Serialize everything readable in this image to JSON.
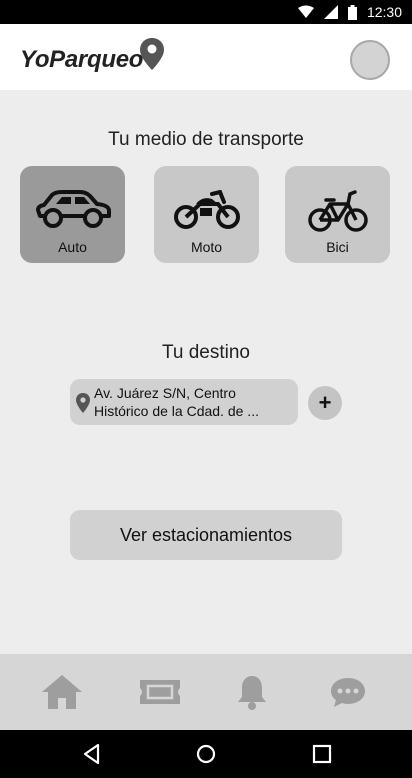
{
  "status_bar": {
    "time": "12:30",
    "icons": [
      "wifi-icon",
      "cell-signal-icon",
      "battery-icon"
    ]
  },
  "header": {
    "app_name": "YoParqueo",
    "logo_icon": "location-pin-icon",
    "avatar": "profile-avatar"
  },
  "transport": {
    "title": "Tu medio de transporte",
    "options": [
      {
        "label": "Auto",
        "icon": "car-icon",
        "selected": true
      },
      {
        "label": "Moto",
        "icon": "motorcycle-icon",
        "selected": false
      },
      {
        "label": "Bici",
        "icon": "bicycle-icon",
        "selected": false
      }
    ]
  },
  "destination": {
    "title": "Tu destino",
    "value": "Av. Juárez S/N, Centro Histórico de la Cdad. de ...",
    "add_label": "+"
  },
  "cta": {
    "label": "Ver estacionamientos"
  },
  "bottom_nav": {
    "items": [
      "home-icon",
      "ticket-icon",
      "bell-icon",
      "chat-icon"
    ]
  },
  "system_nav": {
    "items": [
      "back-icon",
      "home-circle-icon",
      "recents-icon"
    ]
  },
  "colors": {
    "background": "#ededed",
    "selected_tile": "#9a9a9a",
    "tile": "#c8c8c8",
    "nav_icon": "#9e9e9e"
  }
}
